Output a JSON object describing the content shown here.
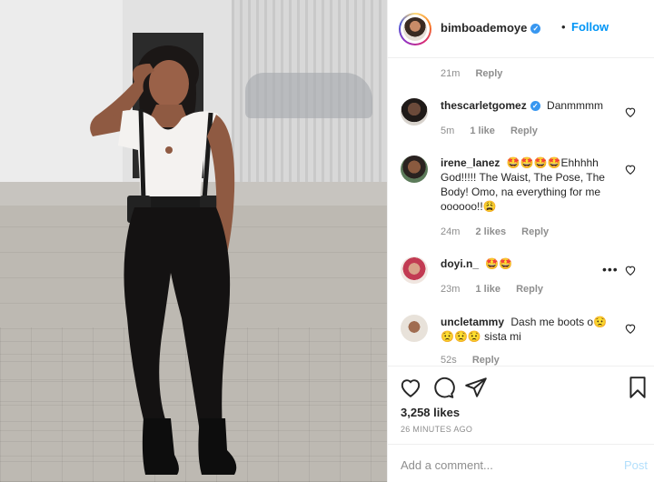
{
  "post": {
    "username": "bimboademoye",
    "follow_label": "Follow",
    "separator": "•"
  },
  "previous_comment_meta": {
    "time": "21m",
    "reply_label": "Reply"
  },
  "comments": [
    {
      "username": "thescarletgomez",
      "verified": true,
      "text": "Danmmmm",
      "time": "5m",
      "likes": "1 like",
      "reply_label": "Reply"
    },
    {
      "username": "irene_lanez",
      "text": "🤩🤩🤩🤩Ehhhhh God!!!!! The Waist, The Pose, The Body! Omo, na everything for me oooooo!!😩",
      "time": "24m",
      "likes": "2 likes",
      "reply_label": "Reply"
    },
    {
      "username": "doyi.n_",
      "text": "🤩🤩",
      "time": "23m",
      "likes": "1 like",
      "reply_label": "Reply",
      "more_label": "•••"
    },
    {
      "username": "uncletammy",
      "text": "Dash me boots o😟 😟😟😟 sista mi",
      "time": "52s",
      "reply_label": "Reply"
    }
  ],
  "actions": {
    "likes_count": "3,258 likes",
    "age": "26 MINUTES AGO",
    "icons": [
      "heart-icon",
      "comment-icon",
      "share-icon",
      "bookmark-icon"
    ]
  },
  "composer": {
    "placeholder": "Add a comment...",
    "post_label": "Post"
  },
  "colors": {
    "accent": "#0095f6",
    "post_disabled": "#b2dffc",
    "muted": "#8e8e8e",
    "text": "#262626"
  }
}
